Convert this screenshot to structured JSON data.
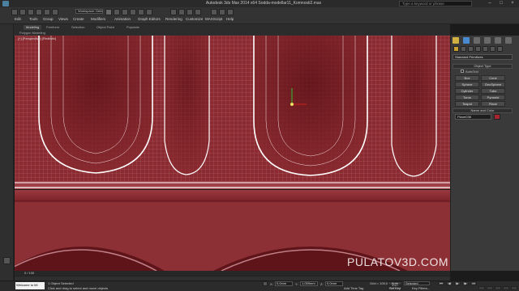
{
  "window": {
    "title": "Autodesk 3ds Max 2014 x64    Sodda-modellar11_Komnosti2.max",
    "search_placeholder": "Type a keyword or phrase"
  },
  "toolbar": {
    "workspace": "Workspace: Default",
    "view_select": "View",
    "menus": [
      "Edit",
      "Tools",
      "Group",
      "Views",
      "Create",
      "Modifiers",
      "Animation",
      "Graph Editors",
      "Rendering",
      "Customize",
      "MAXScript",
      "Help"
    ]
  },
  "ribbon": {
    "tabs": [
      "Modeling",
      "Freeform",
      "Selection",
      "Object Paint",
      "Populate"
    ],
    "sub_label": "Polygon Modeling"
  },
  "viewport": {
    "label": "[+] [Perspective] [Realistic]",
    "watermark": "PULATOV3D.COM"
  },
  "command_panel": {
    "primitive_type": "Standard Primitives",
    "object_type_header": "Object Type",
    "autogrid_label": "AutoGrid",
    "object_buttons": [
      "Box",
      "Cone",
      "Sphere",
      "GeoSphere",
      "Cylinder",
      "Tube",
      "Torus",
      "Pyramid",
      "Teapot",
      "Plane"
    ],
    "name_color_header": "Name and Color",
    "object_name": "Plane038",
    "object_color": "#a8252f"
  },
  "timeline": {
    "position": "0 / 100"
  },
  "status": {
    "maxscript_text": "Welcome to MI",
    "selected_text": "1 Object Selected",
    "prompt_text": "Click and drag to select and move objects",
    "x_label": "X:",
    "x_value": "0,0mm",
    "y_label": "Y:",
    "y_value": "1,059mm",
    "z_label": "Z:",
    "z_value": "0,0mm",
    "grid_text": "Grid = 100,0mm",
    "add_time_tag": "Add Time Tag",
    "auto_key": "Auto Key",
    "set_key": "Set Key",
    "selected_option": "Selected",
    "key_filters": "Key Filters..."
  },
  "colors": {
    "viewport_red": "#8b2a30",
    "wire_white": "#ffffff"
  }
}
